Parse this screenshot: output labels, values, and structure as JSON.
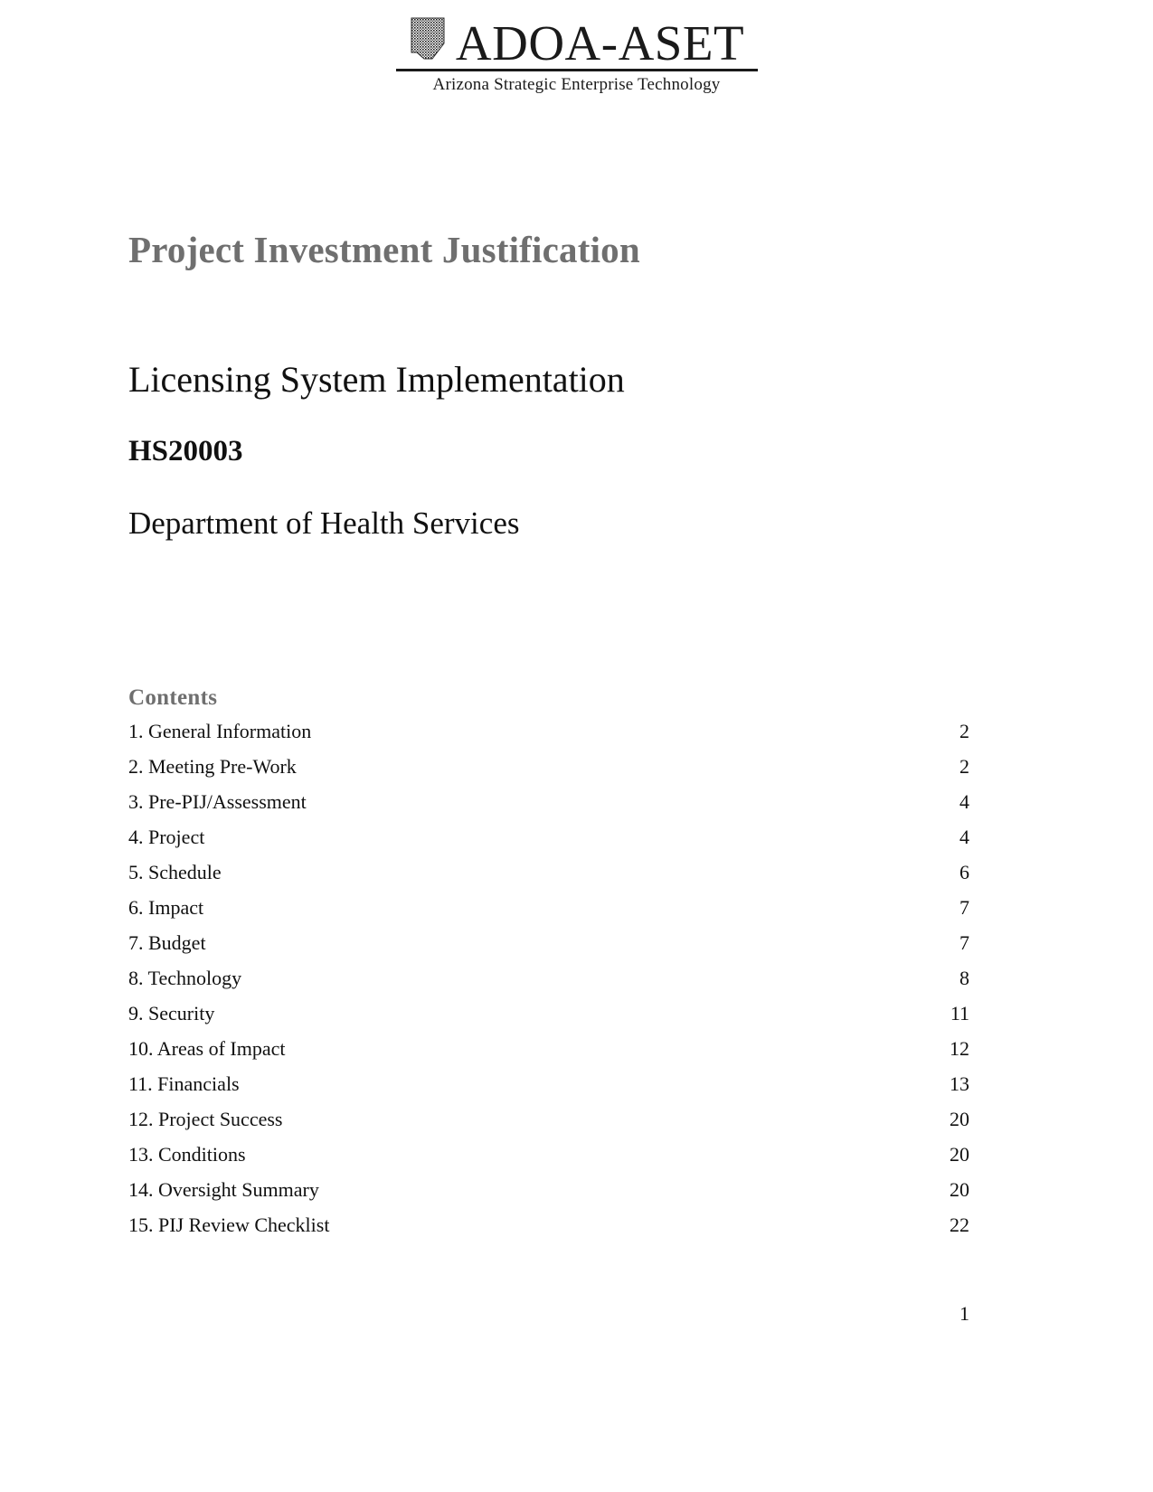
{
  "logo": {
    "mark_icon": "arizona-state-outline-icon",
    "wordmark": "ADOA-ASET",
    "tagline": "Arizona Strategic Enterprise Technology"
  },
  "document": {
    "heading": "Project Investment Justification",
    "subject": "Licensing System Implementation",
    "code": "HS20003",
    "agency": "Department of Health Services"
  },
  "contents": {
    "heading": "Contents",
    "entries": [
      {
        "label": "1. General Information",
        "page": "2"
      },
      {
        "label": "2. Meeting Pre-Work",
        "page": "2"
      },
      {
        "label": "3. Pre-PIJ/Assessment",
        "page": "4"
      },
      {
        "label": "4. Project",
        "page": "4"
      },
      {
        "label": "5. Schedule",
        "page": "6"
      },
      {
        "label": "6. Impact",
        "page": "7"
      },
      {
        "label": "7. Budget",
        "page": "7"
      },
      {
        "label": "8. Technology",
        "page": "8"
      },
      {
        "label": "9. Security",
        "page": "11"
      },
      {
        "label": "10. Areas of Impact",
        "page": "12"
      },
      {
        "label": "11. Financials",
        "page": "13"
      },
      {
        "label": "12. Project Success",
        "page": "20"
      },
      {
        "label": "13. Conditions",
        "page": "20"
      },
      {
        "label": "14. Oversight Summary",
        "page": "20"
      },
      {
        "label": "15. PIJ Review Checklist",
        "page": "22"
      }
    ]
  },
  "footer": {
    "page_number": "1"
  },
  "colors": {
    "heading_gray": "#6f6f6f",
    "body_black": "#111111",
    "page_background": "#ffffff"
  }
}
